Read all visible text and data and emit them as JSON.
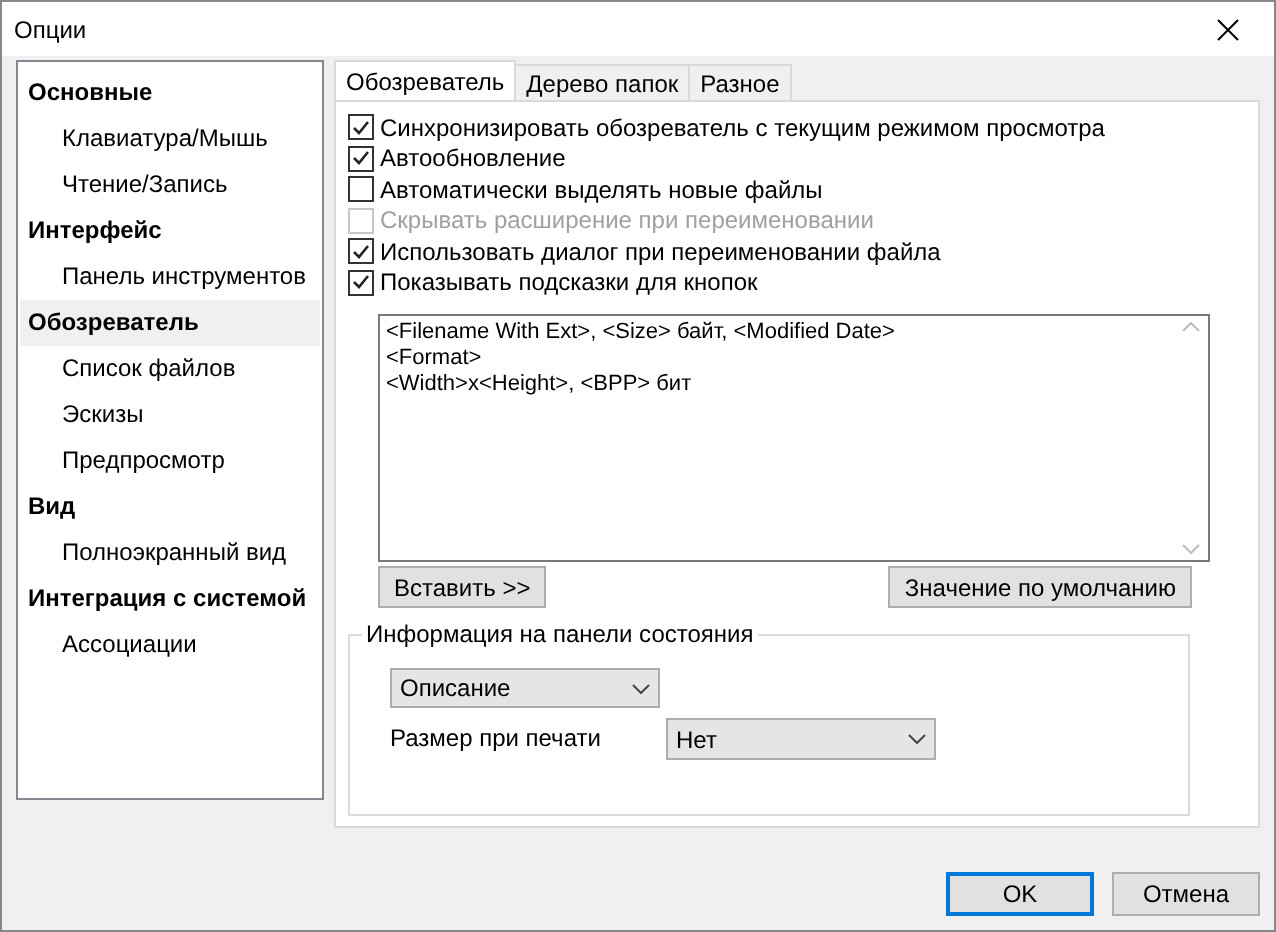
{
  "window": {
    "title": "Опции"
  },
  "sidebar": {
    "items": [
      {
        "kind": "category",
        "label": "Основные",
        "selected": false
      },
      {
        "kind": "item",
        "label": "Клавиатура/Мышь",
        "selected": false
      },
      {
        "kind": "item",
        "label": "Чтение/Запись",
        "selected": false
      },
      {
        "kind": "category",
        "label": "Интерфейс",
        "selected": false
      },
      {
        "kind": "item",
        "label": "Панель инструментов",
        "selected": false
      },
      {
        "kind": "category",
        "label": "Обозреватель",
        "selected": true
      },
      {
        "kind": "item",
        "label": "Список файлов",
        "selected": false
      },
      {
        "kind": "item",
        "label": "Эскизы",
        "selected": false
      },
      {
        "kind": "item",
        "label": "Предпросмотр",
        "selected": false
      },
      {
        "kind": "category",
        "label": "Вид",
        "selected": false
      },
      {
        "kind": "item",
        "label": "Полноэкранный вид",
        "selected": false
      },
      {
        "kind": "category",
        "label": "Интеграция с системой",
        "selected": false
      },
      {
        "kind": "item",
        "label": "Ассоциации",
        "selected": false
      }
    ]
  },
  "tabs": [
    {
      "label": "Обозреватель",
      "selected": true
    },
    {
      "label": "Дерево папок",
      "selected": false
    },
    {
      "label": "Разное",
      "selected": false
    }
  ],
  "options": [
    {
      "label": "Синхронизировать обозреватель с текущим режимом просмотра",
      "checked": true,
      "disabled": false
    },
    {
      "label": "Автообновление",
      "checked": true,
      "disabled": false
    },
    {
      "label": "Автоматически выделять новые файлы",
      "checked": false,
      "disabled": false
    },
    {
      "label": "Скрывать расширение при переименовании",
      "checked": false,
      "disabled": true
    },
    {
      "label": "Использовать диалог при переименовании файла",
      "checked": true,
      "disabled": false
    },
    {
      "label": "Показывать подсказки для кнопок",
      "checked": true,
      "disabled": false
    }
  ],
  "tooltip_template": {
    "value": "<Filename With Ext>, <Size> байт, <Modified Date>\n<Format>\n<Width>x<Height>, <BPP> бит"
  },
  "template_buttons": {
    "insert": "Вставить >>",
    "default": "Значение по умолчанию"
  },
  "status_bar_group": {
    "title": "Информация на панели состояния",
    "info_select": "Описание",
    "print_size_label": "Размер при печати",
    "print_size_select": "Нет"
  },
  "buttons": [
    "OK",
    "Отмена"
  ]
}
